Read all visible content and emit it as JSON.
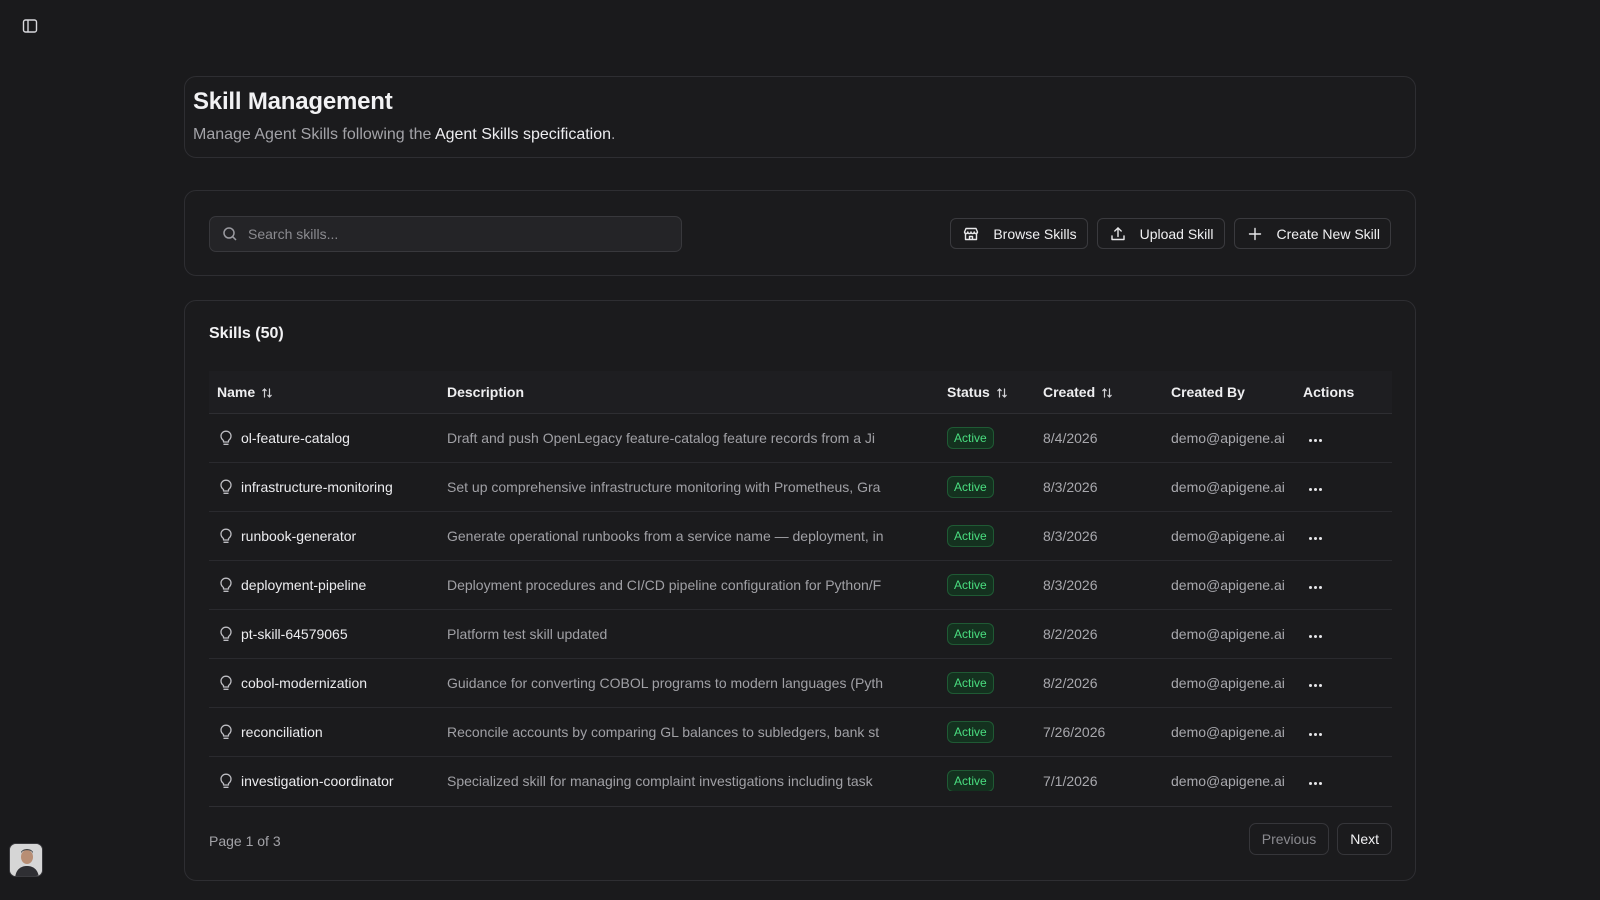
{
  "header": {
    "title": "Skill Management",
    "subtitle_prefix": "Manage Agent Skills following the ",
    "subtitle_link": "Agent Skills specification",
    "subtitle_suffix": "."
  },
  "toolbar": {
    "search_placeholder": "Search skills...",
    "browse_label": "Browse Skills",
    "upload_label": "Upload Skill",
    "create_label": "Create New Skill"
  },
  "table": {
    "title": "Skills (50)",
    "columns": {
      "name": "Name",
      "description": "Description",
      "status": "Status",
      "created": "Created",
      "created_by": "Created By",
      "actions": "Actions"
    },
    "rows": [
      {
        "name": "ol-feature-catalog",
        "description": "Draft and push OpenLegacy feature-catalog feature records from a Ji",
        "status": "Active",
        "created": "8/4/2026",
        "created_by": "demo@apigene.ai"
      },
      {
        "name": "infrastructure-monitoring",
        "description": "Set up comprehensive infrastructure monitoring with Prometheus, Gra",
        "status": "Active",
        "created": "8/3/2026",
        "created_by": "demo@apigene.ai"
      },
      {
        "name": "runbook-generator",
        "description": "Generate operational runbooks from a service name — deployment, in",
        "status": "Active",
        "created": "8/3/2026",
        "created_by": "demo@apigene.ai"
      },
      {
        "name": "deployment-pipeline",
        "description": "Deployment procedures and CI/CD pipeline configuration for Python/F",
        "status": "Active",
        "created": "8/3/2026",
        "created_by": "demo@apigene.ai"
      },
      {
        "name": "pt-skill-64579065",
        "description": "Platform test skill updated",
        "status": "Active",
        "created": "8/2/2026",
        "created_by": "demo@apigene.ai"
      },
      {
        "name": "cobol-modernization",
        "description": "Guidance for converting COBOL programs to modern languages (Pyth",
        "status": "Active",
        "created": "8/2/2026",
        "created_by": "demo@apigene.ai"
      },
      {
        "name": "reconciliation",
        "description": "Reconcile accounts by comparing GL balances to subledgers, bank st",
        "status": "Active",
        "created": "7/26/2026",
        "created_by": "demo@apigene.ai"
      },
      {
        "name": "investigation-coordinator",
        "description": "Specialized skill for managing complaint investigations including task",
        "status": "Active",
        "created": "7/1/2026",
        "created_by": "demo@apigene.ai"
      }
    ]
  },
  "pagination": {
    "info": "Page 1 of 3",
    "previous_label": "Previous",
    "next_label": "Next"
  },
  "colors": {
    "background": "#1a1a1c",
    "status_active": "#4ade80"
  },
  "icons": {
    "sidebar_toggle": "sidebar-panel-icon",
    "search": "search-icon",
    "browse": "store-icon",
    "upload": "upload-icon",
    "create": "plus-icon",
    "row": "lightbulb-icon",
    "sort": "sort-arrows-icon",
    "actions": "more-horizontal-icon"
  }
}
